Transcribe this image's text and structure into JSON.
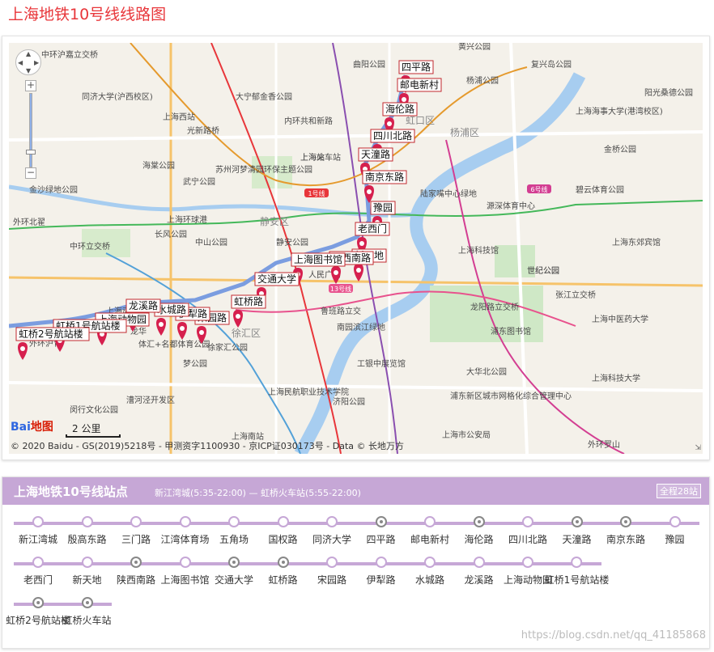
{
  "page": {
    "title": "上海地铁10号线线路图"
  },
  "map": {
    "copyright": "© 2020 Baidu - GS(2019)5218号 - 甲测资字1100930 - 京ICP证030173号 - Data © 长地万方",
    "scale_label": "2 公里",
    "logo_text": "Bai",
    "logo_text2": "地图",
    "labels": [
      "中环沪嘉立交桥",
      "同济大学(沪西校区)",
      "上海西站",
      "光新路桥",
      "大宁郁金香公园",
      "内环共和新路",
      "曲阳公园",
      "黄兴公园",
      "复兴岛公园",
      "杨浦公园",
      "杨浦区",
      "上海海事大学(港湾校区)",
      "阳光桑德公园",
      "金桥公园",
      "碧云体育公园",
      "源深体育中心",
      "陆家嘴中心绿地",
      "上海东郊宾馆",
      "世纪公园",
      "张江立交桥",
      "上海中医药大学",
      "上海科技大学",
      "浦东图书馆",
      "龙阳路立交桥",
      "大华北公园",
      "浦东新区城市网格化综合管理中心",
      "上海市公安局",
      "外环罗山",
      "上海南站",
      "上海民航职业技术学院",
      "济阳公园",
      "漕河泾开发区",
      "闵行文化公园",
      "体汇+名都体育公园",
      "外环沪青",
      "外环北翟",
      "中环立交桥",
      "上海环球港",
      "长风公园",
      "中山公园",
      "静安区",
      "武宁公园",
      "苏州河梦清园环保主题公园",
      "金沙绿地公园",
      "海棠公园",
      "上海站",
      "静安公园",
      "鲁班路立交",
      "南园滨江绿地",
      "徐汇区",
      "徐家汇公园",
      "梦公园",
      "上海体育场",
      "工银中展览馆",
      "世纪公园",
      "虹口区",
      "上海科技馆",
      "上海动物园",
      "上海火车站",
      "龙华",
      "复兴公园",
      "人民广场"
    ],
    "pins": [
      {
        "name": "四平路"
      },
      {
        "name": "邮电新村"
      },
      {
        "name": "海伦路"
      },
      {
        "name": "四川北路"
      },
      {
        "name": "天潼路"
      },
      {
        "name": "南京东路"
      },
      {
        "name": "豫园"
      },
      {
        "name": "老西门"
      },
      {
        "name": "新天地"
      },
      {
        "name": "陕西南路"
      },
      {
        "name": "上海图书馆"
      },
      {
        "name": "交通大学"
      },
      {
        "name": "虹桥路"
      },
      {
        "name": "宋园路"
      },
      {
        "name": "伊犁路"
      },
      {
        "name": "水城路"
      },
      {
        "name": "龙溪路"
      },
      {
        "name": "上海动物园"
      },
      {
        "name": "虹桥1号航站楼"
      },
      {
        "name": "虹桥2号航站楼"
      }
    ],
    "line_badges": [
      "1号线",
      "6号线",
      "13号线"
    ],
    "zoom_in": "+",
    "zoom_out": "−"
  },
  "station_panel": {
    "title": "上海地铁10号线站点",
    "route_info": "新江湾城(5:35-22:00) — 虹桥火车站(5:55-22:00)",
    "total": "全程28站",
    "rows": [
      [
        {
          "name": "新江湾城",
          "transfer": false
        },
        {
          "name": "殷高东路",
          "transfer": false
        },
        {
          "name": "三门路",
          "transfer": false
        },
        {
          "name": "江湾体育场",
          "transfer": false
        },
        {
          "name": "五角场",
          "transfer": false
        },
        {
          "name": "国权路",
          "transfer": false
        },
        {
          "name": "同济大学",
          "transfer": false
        },
        {
          "name": "四平路",
          "transfer": true
        },
        {
          "name": "邮电新村",
          "transfer": false
        },
        {
          "name": "海伦路",
          "transfer": true
        },
        {
          "name": "四川北路",
          "transfer": false
        },
        {
          "name": "天潼路",
          "transfer": true
        },
        {
          "name": "南京东路",
          "transfer": true
        },
        {
          "name": "豫园",
          "transfer": false
        }
      ],
      [
        {
          "name": "老西门",
          "transfer": false
        },
        {
          "name": "新天地",
          "transfer": false
        },
        {
          "name": "陕西南路",
          "transfer": true
        },
        {
          "name": "上海图书馆",
          "transfer": false
        },
        {
          "name": "交通大学",
          "transfer": true
        },
        {
          "name": "虹桥路",
          "transfer": true
        },
        {
          "name": "宋园路",
          "transfer": false
        },
        {
          "name": "伊犁路",
          "transfer": false
        },
        {
          "name": "水城路",
          "transfer": false
        },
        {
          "name": "龙溪路",
          "transfer": false
        },
        {
          "name": "上海动物园",
          "transfer": false
        },
        {
          "name": "虹桥1号航站楼",
          "transfer": false
        }
      ],
      [
        {
          "name": "虹桥2号航站楼",
          "transfer": true
        },
        {
          "name": "虹桥火车站",
          "transfer": true
        }
      ]
    ]
  },
  "watermark": "https://blog.csdn.net/qq_41185868",
  "colors": {
    "title_red": "#e8363a",
    "line_purple": "#c6a7d6",
    "route_blue": "#7b9de0",
    "pin_red": "#d6204e"
  }
}
